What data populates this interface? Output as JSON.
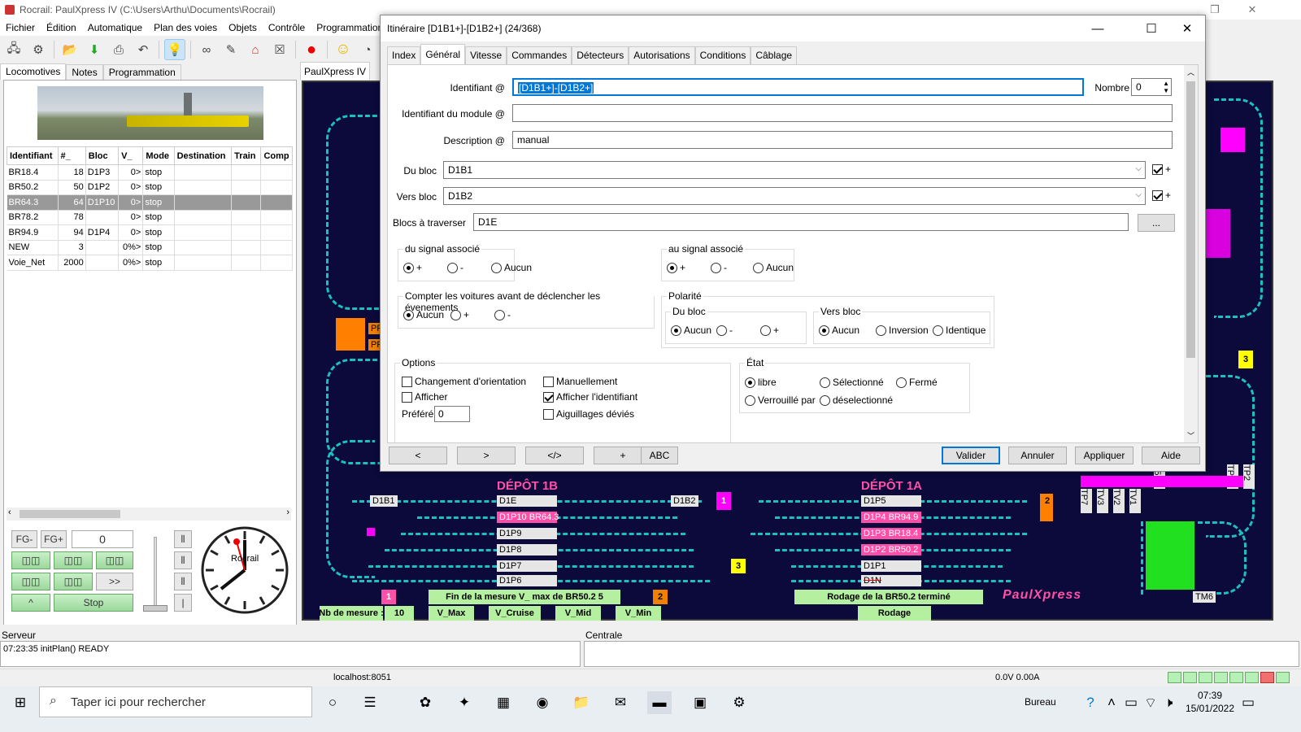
{
  "app": {
    "title": "Rocrail: PaulXpress IV (C:\\Users\\Arthu\\Documents\\Rocrail)",
    "menu": [
      "Fichier",
      "Édition",
      "Automatique",
      "Plan des voies",
      "Objets",
      "Contrôle",
      "Programmation"
    ]
  },
  "left": {
    "tabs": [
      "Locomotives",
      "Notes",
      "Programmation"
    ],
    "table": {
      "headers": [
        "Identifiant",
        "#_",
        "Bloc",
        "V_",
        "Mode",
        "Destination",
        "Train",
        "Comp"
      ],
      "rows": [
        [
          "BR18.4",
          "18",
          "D1P3",
          "0>",
          "stop"
        ],
        [
          "BR50.2",
          "50",
          "D1P2",
          "0>",
          "stop"
        ],
        [
          "BR64.3",
          "64",
          "D1P10",
          "0>",
          "stop"
        ],
        [
          "BR78.2",
          "78",
          "",
          "0>",
          "stop"
        ],
        [
          "BR94.9",
          "94",
          "D1P4",
          "0>",
          "stop"
        ],
        [
          "NEW",
          "3",
          "",
          "0%>",
          "stop"
        ],
        [
          "Voie_Net",
          "2000",
          "",
          "0%>",
          "stop"
        ]
      ]
    },
    "controls": {
      "fg_minus": "FG-",
      "fg_plus": "FG+",
      "speed": "0",
      "more": ">>",
      "up": "^",
      "stop": "Stop",
      "clock_brand": "Rocrail"
    }
  },
  "plan": {
    "tab": "PaulXpress IV",
    "depot1b": "DÉPÔT 1B",
    "depot1a": "DÉPÔT 1A",
    "blocks_left": [
      "D1B1",
      "D1E",
      "D1P10 BR64.3",
      "D1P9",
      "D1P8",
      "D1P7",
      "D1P6",
      "D1B2"
    ],
    "blocks_right": [
      "D1P5",
      "D1P4 BR94.9",
      "D1P3 BR18.4",
      "D1P2 BR50.2",
      "D1P1",
      "D1N"
    ],
    "blocks_side": [
      "PF",
      "PF",
      "TM6",
      "TP7",
      "TV3",
      "TV2",
      "TV1",
      "TP3",
      "TP2",
      "V5"
    ],
    "msg_left": "Fin de la mesure V_ max de BR50.2 5",
    "msg_right": "Rodage de la BR50.2 terminé",
    "mesure_label": "Nb de mesure :",
    "mesure_value": "10",
    "speeds": [
      "V_Max",
      "V_Cruise",
      "V_Mid",
      "V_Min"
    ],
    "rodage": "Rodage",
    "brand": "PaulXpress",
    "numbers": [
      "1",
      "2",
      "3",
      "1",
      "2",
      "3",
      "3"
    ]
  },
  "dialog": {
    "title": "Itinéraire [D1B1+]-[D1B2+] (24/368)",
    "tabs": [
      "Index",
      "Général",
      "Vitesse",
      "Commandes",
      "Détecteurs",
      "Autorisations",
      "Conditions",
      "Câblage"
    ],
    "fields": {
      "id_label": "Identifiant @",
      "id_value": "[D1B1+]-[D1B2+]",
      "nombre_label": "Nombre",
      "nombre_value": "0",
      "module_label": "Identifiant du module @",
      "module_value": "",
      "desc_label": "Description @",
      "desc_value": "manual",
      "from_label": "Du bloc",
      "from_value": "D1B1",
      "to_label": "Vers bloc",
      "to_value": "D1B2",
      "plus": "+",
      "cross_label": "Blocs à traverser",
      "cross_value": "D1E",
      "browse": "..."
    },
    "signal_from": {
      "title": "du signal associé",
      "opts": [
        "+",
        "-",
        "Aucun"
      ]
    },
    "signal_to": {
      "title": "au signal associé",
      "opts": [
        "+",
        "-",
        "Aucun"
      ]
    },
    "count": {
      "title": "Compter les voitures avant de déclencher les évenements",
      "opts": [
        "Aucun",
        "+",
        "-"
      ]
    },
    "polarity": {
      "title": "Polarité",
      "from_title": "Du bloc",
      "from_opts": [
        "Aucun",
        "-",
        "+"
      ],
      "to_title": "Vers bloc",
      "to_opts": [
        "Aucun",
        "Inversion",
        "Identique"
      ]
    },
    "options": {
      "title": "Options",
      "c1": "Changement d'orientation",
      "c2": "Manuellement",
      "c3": "Afficher",
      "c4": "Afficher l'identifiant",
      "c5": "Aiguillages déviés",
      "pref_label": "Préféré",
      "pref_value": "0"
    },
    "state": {
      "title": "État",
      "opts": [
        "libre",
        "Sélectionné",
        "Fermé",
        "Verrouillé par",
        "déselectionné"
      ]
    },
    "nav": [
      "<",
      ">",
      "</>",
      "+",
      "ABC"
    ],
    "buttons": [
      "Valider",
      "Annuler",
      "Appliquer",
      "Aide"
    ]
  },
  "bottom": {
    "server_label": "Serveur",
    "server_log": "07:23:35 initPlan() READY",
    "central_label": "Centrale",
    "host": "localhost:8051",
    "power": "0.0V 0.00A"
  },
  "taskbar": {
    "search_placeholder": "Taper ici pour rechercher",
    "desk": "Bureau",
    "time": "07:39",
    "date": "15/01/2022"
  }
}
